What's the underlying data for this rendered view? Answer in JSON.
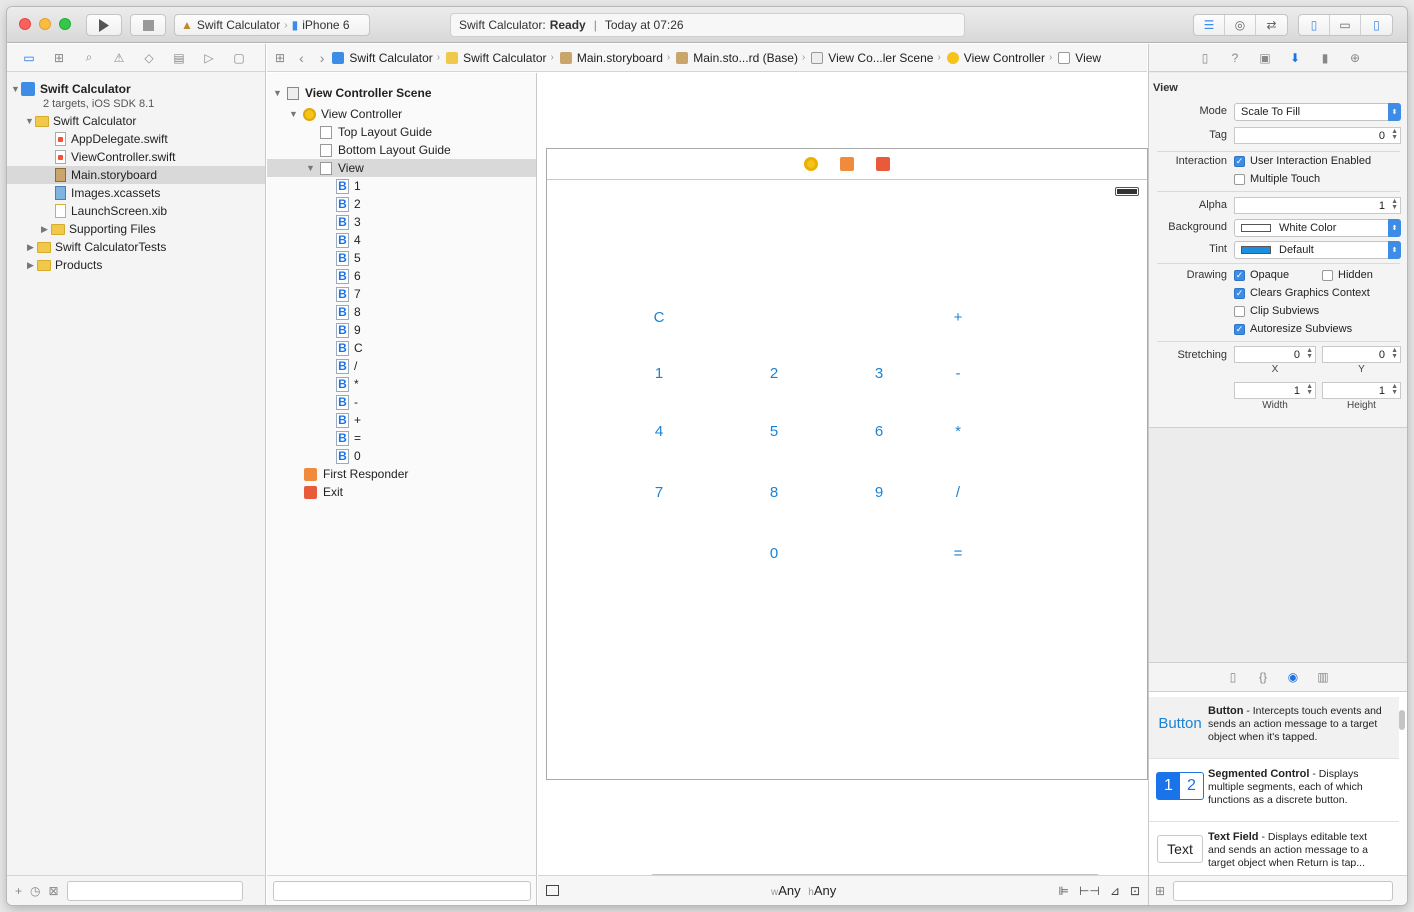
{
  "toolbar": {
    "scheme_target": "Swift Calculator",
    "scheme_device": "iPhone 6",
    "status_prefix": "Swift Calculator:",
    "status_state": "Ready",
    "status_time": "Today at 07:26"
  },
  "navigator": {
    "project_name": "Swift Calculator",
    "project_sub": "2 targets, iOS SDK 8.1",
    "group_main": "Swift Calculator",
    "files": [
      "AppDelegate.swift",
      "ViewController.swift",
      "Main.storyboard",
      "Images.xcassets",
      "LaunchScreen.xib"
    ],
    "supporting_files": "Supporting Files",
    "tests_group": "Swift CalculatorTests",
    "products_group": "Products",
    "selected_file": "Main.storyboard"
  },
  "jumpbar": {
    "crumbs": [
      "Swift Calculator",
      "Swift Calculator",
      "Main.storyboard",
      "Main.sto...rd (Base)",
      "View Co...ler Scene",
      "View Controller",
      "View"
    ]
  },
  "outline": {
    "scene": "View Controller Scene",
    "controller": "View Controller",
    "top_guide": "Top Layout Guide",
    "bottom_guide": "Bottom Layout Guide",
    "view": "View",
    "button_glyph": "B",
    "buttons": [
      "1",
      "2",
      "3",
      "4",
      "5",
      "6",
      "7",
      "8",
      "9",
      "C",
      "/",
      "*",
      "-",
      "+",
      "=",
      "0"
    ],
    "first_responder": "First Responder",
    "exit": "Exit"
  },
  "canvas": {
    "calc_buttons": [
      "C",
      "+",
      "1",
      "2",
      "3",
      "-",
      "4",
      "5",
      "6",
      "*",
      "7",
      "8",
      "9",
      "/",
      "0",
      "="
    ],
    "size_w_prefix": "w",
    "size_w": "Any",
    "size_h_prefix": "h",
    "size_h": "Any"
  },
  "inspector": {
    "section": "View",
    "mode_label": "Mode",
    "mode_value": "Scale To Fill",
    "tag_label": "Tag",
    "tag_value": "0",
    "interaction_label": "Interaction",
    "user_interaction": "User Interaction Enabled",
    "multiple_touch": "Multiple Touch",
    "alpha_label": "Alpha",
    "alpha_value": "1",
    "background_label": "Background",
    "background_value": "White Color",
    "tint_label": "Tint",
    "tint_value": "Default",
    "drawing_label": "Drawing",
    "opaque": "Opaque",
    "hidden": "Hidden",
    "clears_graphics": "Clears Graphics Context",
    "clip_subviews": "Clip Subviews",
    "autoresize": "Autoresize Subviews",
    "stretching_label": "Stretching",
    "stretch_x": "0",
    "stretch_y": "0",
    "x_label": "X",
    "y_label": "Y",
    "stretch_w": "1",
    "stretch_h": "1",
    "width_label": "Width",
    "height_label": "Height",
    "checks": {
      "user_interaction": true,
      "multiple_touch": false,
      "opaque": true,
      "hidden": false,
      "clears": true,
      "clip": false,
      "autoresize": true
    },
    "background_color": "#ffffff",
    "tint_color": "#1a8fe0"
  },
  "library": {
    "button_preview": "Button",
    "button_title": "Button",
    "button_desc": " - Intercepts touch events and sends an action message to a target object when it's tapped.",
    "seg_preview_1": "1",
    "seg_preview_2": "2",
    "seg_title": "Segmented Control",
    "seg_desc": " - Displays multiple segments, each of which functions as a discrete button.",
    "text_preview": "Text",
    "text_title": "Text Field",
    "text_desc": " - Displays editable text and sends an action message to a target object when Return is tap..."
  },
  "colors": {
    "accent": "#1a83d6",
    "selection": "#d9d9d9"
  }
}
